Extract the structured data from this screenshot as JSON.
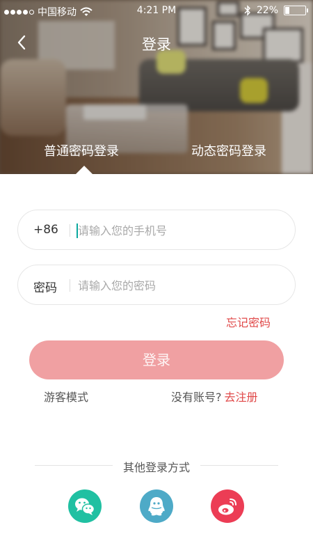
{
  "status_bar": {
    "carrier": "中国移动",
    "time": "4:21 PM",
    "battery_percent": "22%",
    "battery_level": 0.22
  },
  "nav": {
    "title": "登录",
    "back_icon": "chevron-left-icon"
  },
  "tabs": [
    {
      "label": "普通密码登录",
      "active": true
    },
    {
      "label": "动态密码登录",
      "active": false
    }
  ],
  "form": {
    "phone": {
      "prefix": "+86",
      "placeholder": "请输入您的手机号",
      "value": ""
    },
    "password": {
      "label": "密码",
      "placeholder": "请输入您的密码",
      "value": ""
    },
    "forgot_label": "忘记密码",
    "login_label": "登录"
  },
  "links": {
    "guest_label": "游客模式",
    "no_account_text": "没有账号?",
    "register_label": "去注册"
  },
  "other_login": {
    "title": "其他登录方式",
    "providers": [
      {
        "name": "wechat-icon",
        "color": "#20c0a2"
      },
      {
        "name": "qq-icon",
        "color": "#4eaac7"
      },
      {
        "name": "weibo-icon",
        "color": "#ec3d55"
      }
    ]
  },
  "colors": {
    "accent_red": "#e04848",
    "login_button": "#f0a0a2",
    "input_caret": "#0aa89e"
  }
}
